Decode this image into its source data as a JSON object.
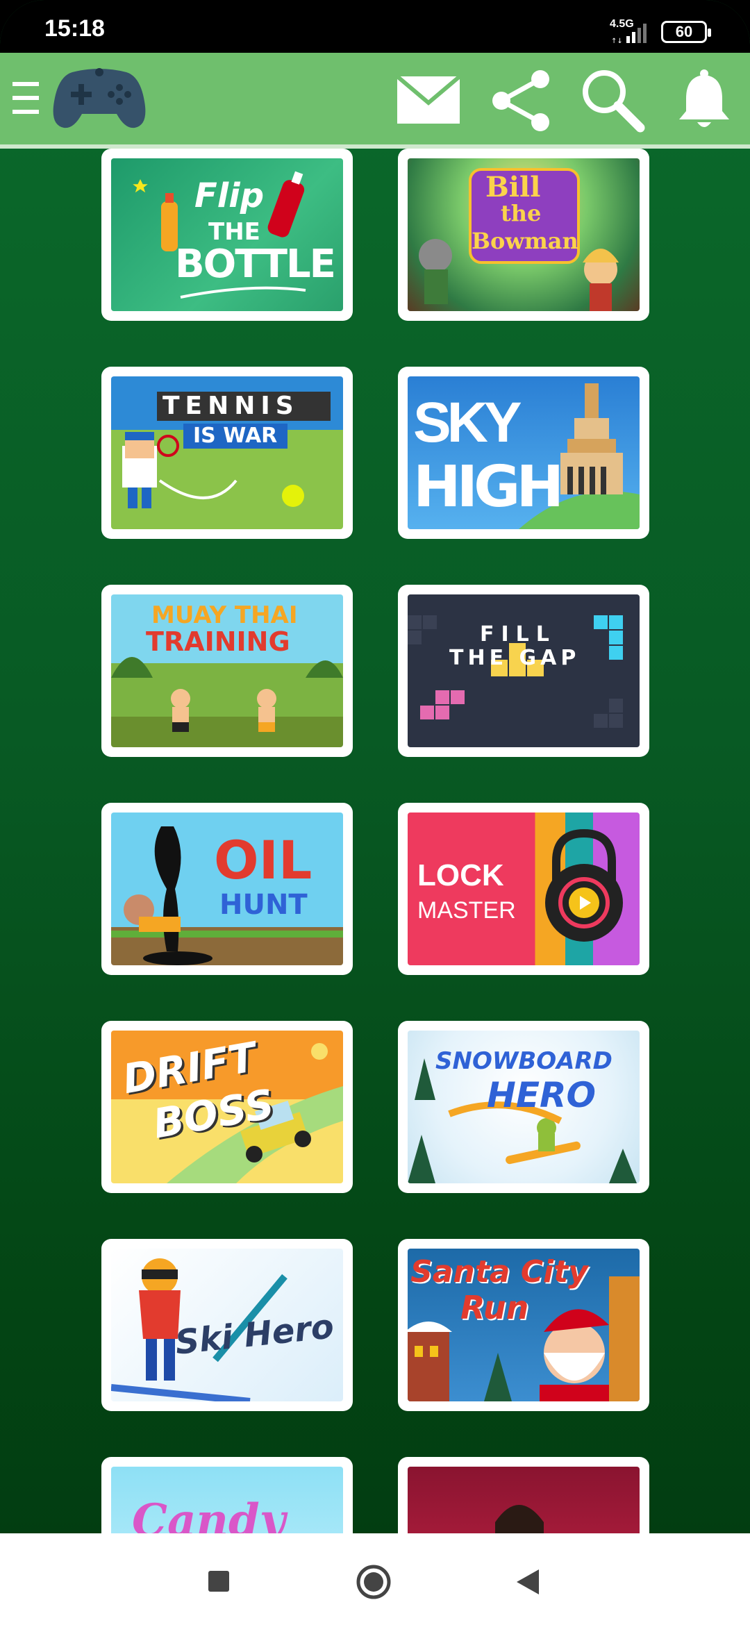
{
  "status_bar": {
    "time": "15:18",
    "network": "4.5G",
    "battery": "60"
  },
  "app_bar": {
    "icons": [
      "menu-icon",
      "gamepad-icon",
      "mail-icon",
      "share-icon",
      "search-icon",
      "bell-icon"
    ]
  },
  "games": [
    {
      "title_line1": "Flip",
      "title_line2": "THE",
      "title_line3": "BOTTLE"
    },
    {
      "title_line1": "Bill",
      "title_line2": "the",
      "title_line3": "Bowman"
    },
    {
      "title_line1": "TENNIS",
      "title_line2": "IS WAR"
    },
    {
      "title_line1": "SKY",
      "title_line2": "HIGH"
    },
    {
      "title_line1": "MUAY THAI",
      "title_line2": "TRAINING"
    },
    {
      "title_line1": "FILL",
      "title_line2": "THE GAP"
    },
    {
      "title_line1": "OIL",
      "title_line2": "HUNT"
    },
    {
      "title_line1": "LOCK",
      "title_line2": "MASTER"
    },
    {
      "title_line1": "DRIFT",
      "title_line2": "BOSS"
    },
    {
      "title_line1": "SNOWBOARD",
      "title_line2": "HERO"
    },
    {
      "title_line1": "Ski Hero"
    },
    {
      "title_line1": "Santa City",
      "title_line2": "Run"
    },
    {
      "title_line1": "Candy"
    },
    {
      "title_line1": ""
    }
  ],
  "nav_bar": {
    "icons": [
      "recents-icon",
      "home-icon",
      "back-icon"
    ]
  }
}
